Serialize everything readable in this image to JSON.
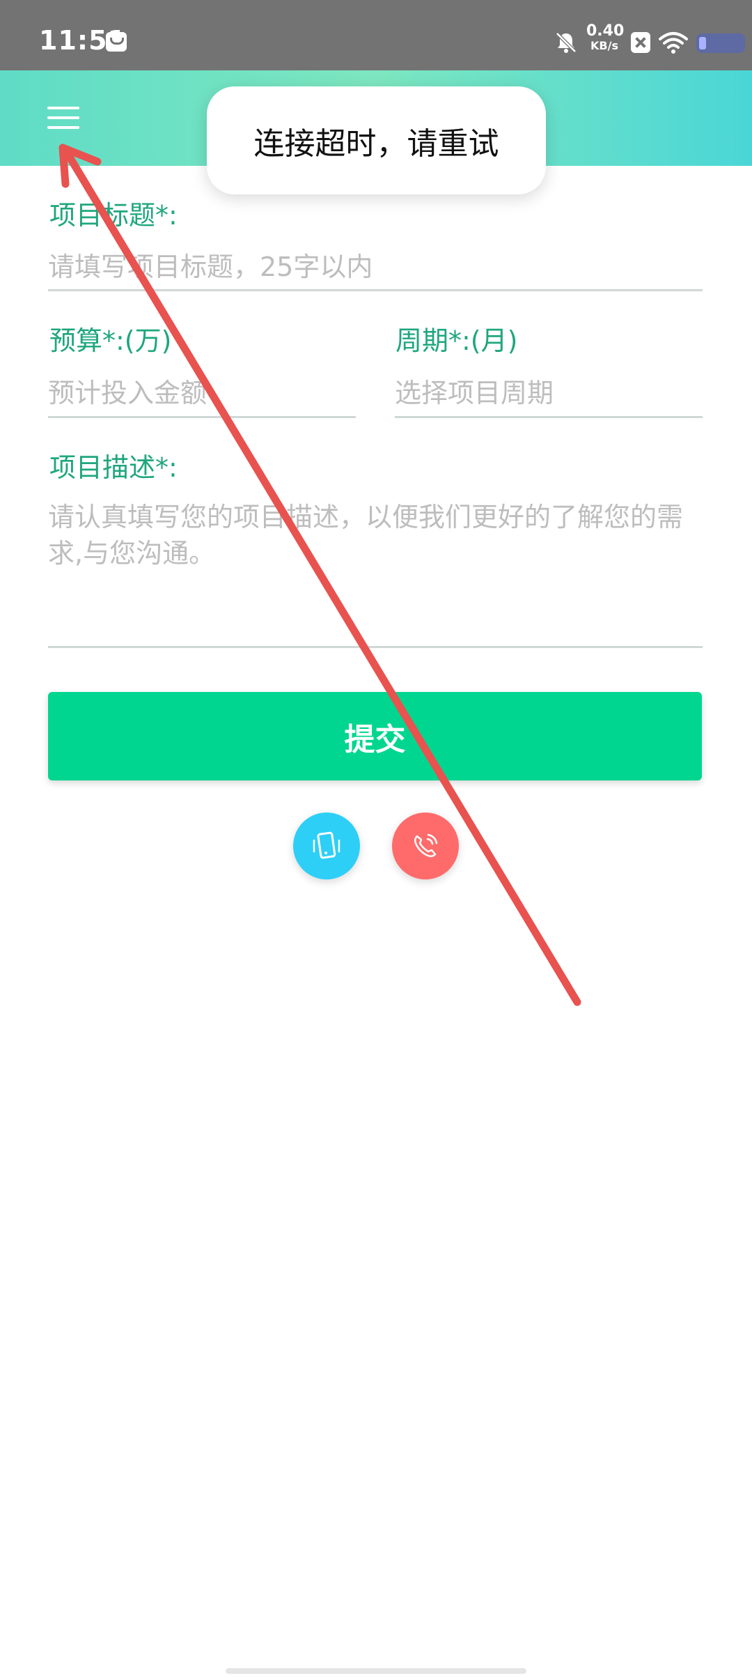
{
  "status_bar": {
    "time": "11:51",
    "net_speed_value": "0.40",
    "net_speed_unit": "KB/s"
  },
  "toast": {
    "message": "连接超时，请重试"
  },
  "form": {
    "title_label": "项目标题*:",
    "title_placeholder": "请填写项目标题，25字以内",
    "budget_label": "预算*:(万)",
    "budget_placeholder": "预计投入金额",
    "period_label": "周期*:(月)",
    "period_placeholder": "选择项目周期",
    "description_label": "项目描述*:",
    "description_placeholder": "请认真填写您的项目描述，以便我们更好的了解您的需求,与您沟通。",
    "submit_label": "提交"
  },
  "colors": {
    "accent": "#1fa67d",
    "submit": "#00d68f",
    "phone_button": "#2ecff7",
    "call_button": "#ff6b6b",
    "annotation_arrow": "#e8524f"
  },
  "icons": {
    "menu": "menu-icon",
    "phone": "mobile-phone-icon",
    "call": "phone-call-icon"
  }
}
